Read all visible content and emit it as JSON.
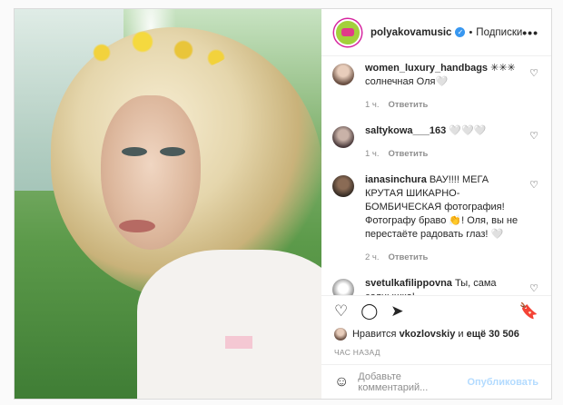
{
  "post": {
    "username": "polyakovamusic",
    "verified_mark": "✓",
    "separator": "•",
    "follow_label": "Подписки",
    "more_label": "•••"
  },
  "comments": [
    {
      "user": "women_luxury_handbags",
      "text": "✳✳✳ солнечная Оля🤍",
      "time": "1 ч.",
      "reply": "Ответить",
      "avatar_icon": "avatar-woman-icon"
    },
    {
      "user": "saltykowa___163",
      "text": "🤍🤍🤍",
      "time": "1 ч.",
      "reply": "Ответить",
      "avatar_icon": "avatar-woman-icon"
    },
    {
      "user": "ianasinchura",
      "text": "ВАУ!!!! МЕГА КРУТАЯ ШИКАРНО-БОМБИЧЕСКАЯ фотография! Фотографу браво 👏! Оля, вы не перестаёте радовать глаз! 🤍",
      "time": "2 ч.",
      "reply": "Ответить",
      "avatar_icon": "avatar-icon"
    },
    {
      "user": "svetulkafilippovna",
      "text": "Ты, сама солнышко!",
      "time": "",
      "reply": "",
      "avatar_icon": "avatar-dog-icon"
    }
  ],
  "likes": {
    "prefix": "Нравится",
    "user": "vkozlovskiy",
    "conj": "и",
    "others": "ещё 30 506"
  },
  "time_ago": "ЧАС НАЗАД",
  "add_comment": {
    "placeholder": "Добавьте комментарий...",
    "publish": "Опубликовать"
  },
  "colors": {
    "accent": "#3897f0",
    "publish_disabled": "#b3dbff",
    "meta": "#8e8e8e"
  }
}
